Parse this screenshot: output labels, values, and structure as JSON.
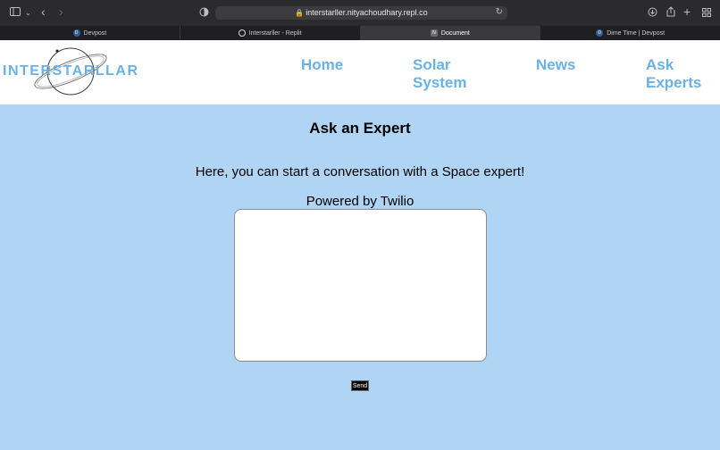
{
  "browser": {
    "url": "interstarller.nityachoudhary.repl.co",
    "tabs": [
      {
        "label": "Devpost",
        "favicon": "D"
      },
      {
        "label": "Interstarller - Replit",
        "favicon": ""
      },
      {
        "label": "Document",
        "favicon": "N"
      },
      {
        "label": "Dime Time | Devpost",
        "favicon": "D"
      }
    ]
  },
  "site": {
    "logo_text": "INTERSTARLLAR",
    "nav": {
      "home": "Home",
      "solar_1": "Solar",
      "solar_2": "System",
      "news": "News",
      "ask_1": "Ask",
      "ask_2": "Experts"
    }
  },
  "main": {
    "title": "Ask an Expert",
    "subtitle": "Here, you can start a conversation with a Space expert!",
    "powered_by": "Powered by Twilio",
    "chat_value": "",
    "send_label": "Send"
  },
  "colors": {
    "page_bg": "#afd4f4",
    "accent": "#6ab2e6",
    "toolbar": "#2b2b2d"
  }
}
